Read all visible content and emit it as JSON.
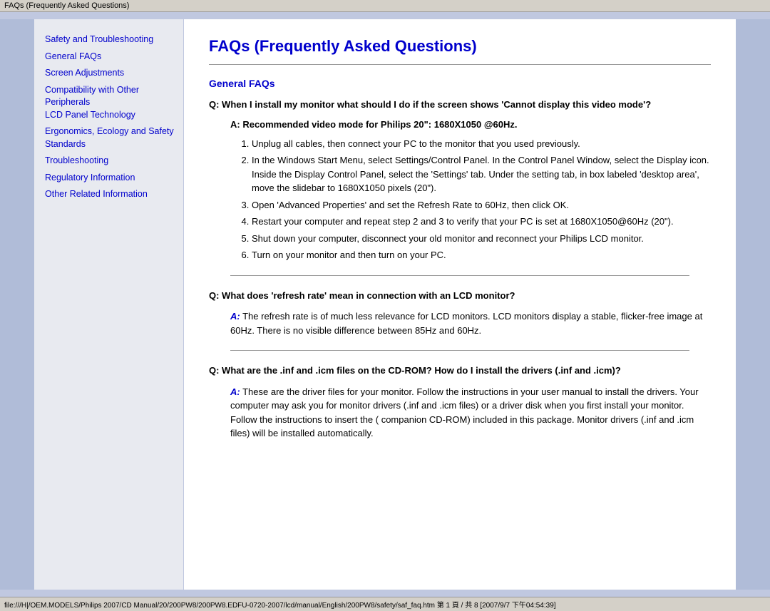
{
  "browser": {
    "title": "FAQs (Frequently Asked Questions)"
  },
  "sidebar": {
    "links": [
      {
        "label": "Safety and Troubleshooting",
        "id": "safety-troubleshooting"
      },
      {
        "label": "General FAQs",
        "id": "general-faqs"
      },
      {
        "label": "Screen Adjustments",
        "id": "screen-adjustments"
      },
      {
        "label": "Compatibility with Other Peripherals",
        "id": "compatibility-other"
      },
      {
        "label": "LCD Panel Technology",
        "id": "lcd-panel"
      },
      {
        "label": "Ergonomics, Ecology and Safety Standards",
        "id": "ergonomics"
      },
      {
        "label": "Troubleshooting",
        "id": "troubleshooting"
      },
      {
        "label": "Regulatory Information",
        "id": "regulatory"
      },
      {
        "label": "Other Related Information",
        "id": "other-related"
      }
    ]
  },
  "main": {
    "title": "FAQs (Frequently Asked Questions)",
    "section1": {
      "title": "General FAQs",
      "q1": {
        "question": "Q: When I install my monitor what should I do if the screen shows 'Cannot display this video mode'?",
        "answer_highlight": "A: Recommended video mode for Philips 20\": 1680X1050 @60Hz.",
        "steps": [
          "Unplug all cables, then connect your PC to the monitor that you used previously.",
          "In the Windows Start Menu, select Settings/Control Panel. In the Control Panel Window, select the Display icon. Inside the Display Control Panel, select the 'Settings' tab. Under the setting tab, in box labeled 'desktop area', move the slidebar to 1680X1050 pixels (20\").",
          "Open 'Advanced Properties' and set the Refresh Rate to 60Hz, then click OK.",
          "Restart your computer and repeat step 2 and 3 to verify that your PC is set at 1680X1050@60Hz (20\").",
          "Shut down your computer, disconnect your old monitor and reconnect your Philips LCD monitor.",
          "Turn on your monitor and then turn on your PC."
        ]
      },
      "q2": {
        "question": "Q: What does 'refresh rate' mean in connection with an LCD monitor?",
        "answer": "A: The refresh rate is of much less relevance for LCD monitors. LCD monitors display a stable, flicker-free image at 60Hz. There is no visible difference between 85Hz and 60Hz."
      },
      "q3": {
        "question": "Q: What are the .inf and .icm files on the CD-ROM? How do I install the drivers (.inf and .icm)?",
        "answer": "A: These are the driver files for your monitor. Follow the instructions in your user manual to install the drivers. Your computer may ask you for monitor drivers (.inf and .icm files) or a driver disk when you first install your monitor. Follow the instructions to insert the ( companion CD-ROM) included in this package. Monitor drivers (.inf and .icm files) will be installed automatically."
      }
    }
  },
  "status_bar": {
    "text": "file:///H|/OEM.MODELS/Philips 2007/CD Manual/20/200PW8/200PW8.EDFU-0720-2007/lcd/manual/English/200PW8/safety/saf_faq.htm 第 1 頁 / 共 8 [2007/9/7 下午04:54:39]"
  }
}
